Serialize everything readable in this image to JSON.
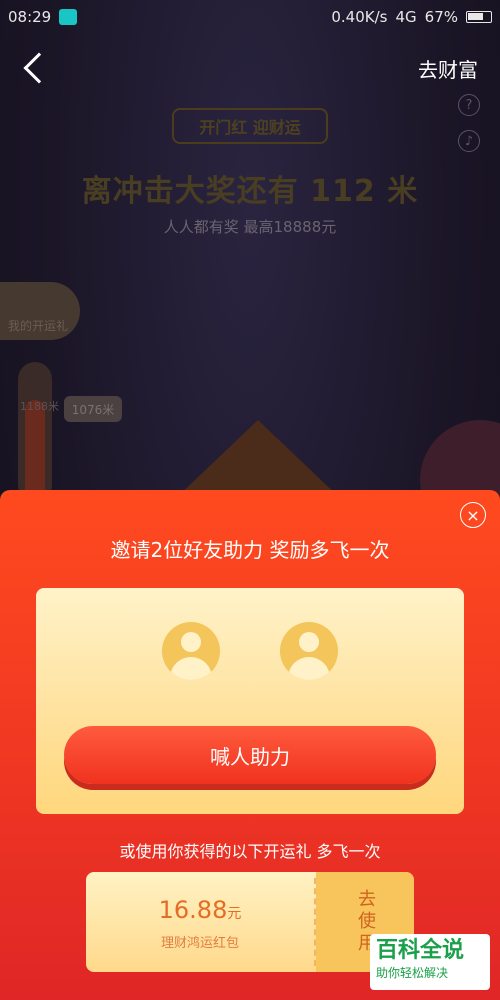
{
  "status_bar": {
    "time": "08:29",
    "net_speed": "0.40K/s",
    "network": "4G",
    "battery": "67%"
  },
  "header": {
    "back_icon": "chevron-left",
    "nav_link": "去财富"
  },
  "background": {
    "pill": "开门红 迎财运",
    "headline": "离冲击大奖还有 112 米",
    "subline": "人人都有奖 最高18888元",
    "gift_tab_label": "我的开运礼",
    "progress_mark": "1188米",
    "distance_bubble": "1076米",
    "help_icon": "?",
    "music_icon": "♪"
  },
  "modal": {
    "close_icon": "×",
    "title": "邀请2位好友助力 奖励多飞一次",
    "shout_button": "喊人助力",
    "alt_line": "或使用你获得的以下开运礼 多飞一次",
    "coupon": {
      "amount": "16.88",
      "unit": "元",
      "name": "理财鸿运红包",
      "use_label": "去使用"
    }
  },
  "watermark": {
    "big": "百科全说",
    "small": "助你轻松解决"
  }
}
